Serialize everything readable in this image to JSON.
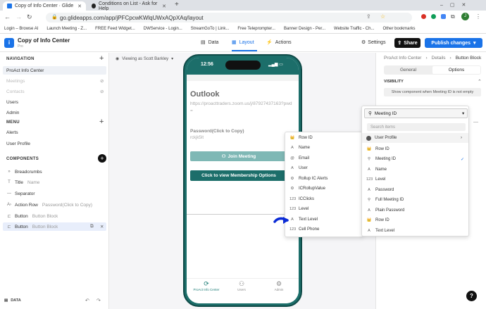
{
  "browser": {
    "tabs": [
      {
        "label": "Copy of Info Center · Glide",
        "active": true
      },
      {
        "label": "Conditions on List - Ask for Help",
        "active": false
      }
    ],
    "url": "go.glideapps.com/app/jPFCpcwKWlqUWxAQpXAq/layout",
    "bookmarks": [
      "Login – Browse AI",
      "Launch Meeting - Z...",
      "FREE Feed Widget...",
      "DWService - Login...",
      "StreamGoTo | Link...",
      "Free Teleprompter...",
      "Banner Design - Per...",
      "Website Traffic - Ch...",
      "Other bookmarks"
    ],
    "avatar": "J"
  },
  "header": {
    "app_title": "Copy of Info Center",
    "app_tier": "Pro",
    "tabs": [
      "Data",
      "Layout",
      "Actions"
    ],
    "active_tab": "Layout",
    "settings": "Settings",
    "share": "Share",
    "publish": "Publish changes"
  },
  "navigation": {
    "nav_title": "NAVIGATION",
    "nav_items": [
      "ProAct Info Center",
      "Meetings",
      "Contacts",
      "Users",
      "Admin"
    ],
    "menu_title": "MENU",
    "menu_items": [
      "Alerts",
      "User Profile"
    ],
    "components_title": "COMPONENTS",
    "components": [
      {
        "name": "Breadcrumbs",
        "sub": ""
      },
      {
        "name": "Title",
        "sub": "Name"
      },
      {
        "name": "Separator",
        "sub": ""
      },
      {
        "name": "Action Row",
        "sub": "Password(Click to Copy)"
      },
      {
        "name": "Button",
        "sub": "Button Block"
      },
      {
        "name": "Button",
        "sub": "Button Block"
      }
    ],
    "data_label": "DATA"
  },
  "canvas": {
    "viewing_as": "Viewing as Scott Barkley"
  },
  "phone": {
    "time": "12:56",
    "title": "Outlook",
    "link": "https://proacttraders.zoom.us/j/87927437163?pwd=",
    "field_label": "Password(Click to Copy)",
    "field_value": "rckjk5It",
    "join_button": "Join Meeting",
    "membership_button": "Click to view Membership Options",
    "tabs": [
      "ProAct Info Center",
      "Users",
      "Admin"
    ]
  },
  "properties": {
    "breadcrumb": [
      "ProAct Info Center",
      "Details",
      "Button Block"
    ],
    "tabs": [
      "General",
      "Options"
    ],
    "active_tab": "Options",
    "visibility_label": "VISIBILITY",
    "visibility_button": "Show component when Meeting ID is not empty"
  },
  "column_list": [
    {
      "icon": "👑",
      "label": "Row ID"
    },
    {
      "icon": "A",
      "label": "Name"
    },
    {
      "icon": "@",
      "label": "Email"
    },
    {
      "icon": "A",
      "label": "User"
    },
    {
      "icon": "⚙",
      "label": "Rollup IC Alerts"
    },
    {
      "icon": "⚙",
      "label": "ICRollupValue"
    },
    {
      "icon": "123",
      "label": "ICClicks"
    },
    {
      "icon": "123",
      "label": "Level"
    },
    {
      "icon": "A",
      "label": "Text Level"
    },
    {
      "icon": "123",
      "label": "Cell Phone"
    }
  ],
  "selector": {
    "selected": "Meeting ID",
    "search_placeholder": "Search items",
    "group": "User Profile",
    "items": [
      {
        "icon": "👑",
        "label": "Row ID"
      },
      {
        "icon": "⚲",
        "label": "Meeting ID",
        "checked": true
      },
      {
        "icon": "A",
        "label": "Name"
      },
      {
        "icon": "123",
        "label": "Level"
      },
      {
        "icon": "A",
        "label": "Password"
      },
      {
        "icon": "⚲",
        "label": "Full Meeting ID"
      },
      {
        "icon": "A",
        "label": "Plain Password"
      },
      {
        "icon": "👑",
        "label": "Row ID"
      },
      {
        "icon": "A",
        "label": "Text Level"
      }
    ]
  },
  "help": "?"
}
